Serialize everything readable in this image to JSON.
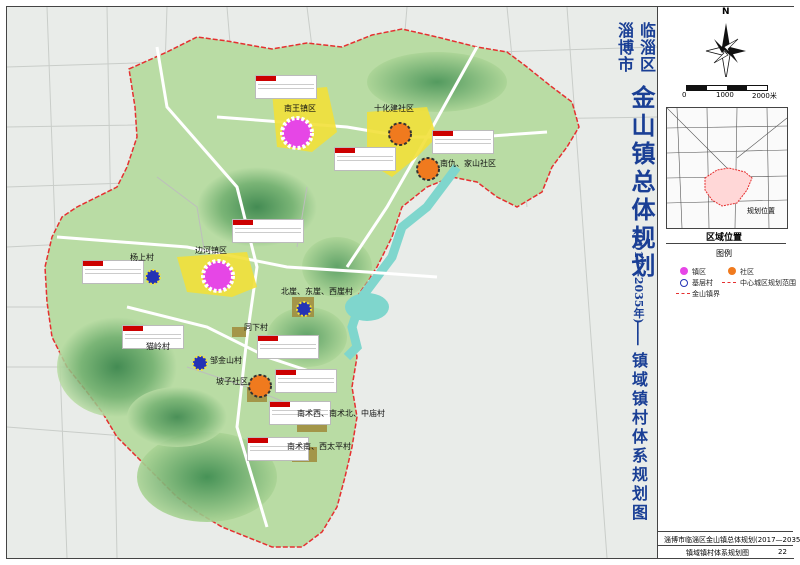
{
  "title": {
    "city": "淄博市",
    "district": "临淄区",
    "main": "金山镇总体规划",
    "period": "(2017—2035年)",
    "dash": "——",
    "sub": "镇域镇村体系规划图"
  },
  "compass": {
    "north": "N"
  },
  "scale": {
    "zero": "0",
    "mid": "1000",
    "end": "2000米"
  },
  "location": {
    "label": "区域位置",
    "site": "规划位置"
  },
  "legend": {
    "title": "图例",
    "items": [
      {
        "label": "镇区"
      },
      {
        "label": "社区"
      },
      {
        "label": "基层村"
      },
      {
        "label": "中心城区规划范围"
      },
      {
        "label": "金山镇界"
      }
    ]
  },
  "places": {
    "nanwang": "南王镇区",
    "shihuajian": "十化建社区",
    "nanlou": "南仇、家山社区",
    "yangshang": "杨上村",
    "bianhe": "边河镇区",
    "beiya": "北崖、东崖、西崖村",
    "tongxia": "同下村",
    "shangshan": "猫岭村",
    "zhejinshan": "邹金山村",
    "pozi": "坡子社区",
    "nanmu": "南术西、南术北、中庙村",
    "nanshu": "南术南、西太平村"
  },
  "footer": {
    "project": "淄博市临淄区金山镇总体规划(2017—2035年)",
    "sheet": "镇域镇村体系规划图",
    "page": "22"
  },
  "colors": {
    "boundary": "#e53030",
    "town": "#e646e6",
    "community": "#f07a1e",
    "village": "#2433b5",
    "builtup": "#f2e03a",
    "green_light": "#b8dca2",
    "green_dark": "#3f8f52",
    "water": "#7fd6cd",
    "title": "#1a3f95"
  }
}
